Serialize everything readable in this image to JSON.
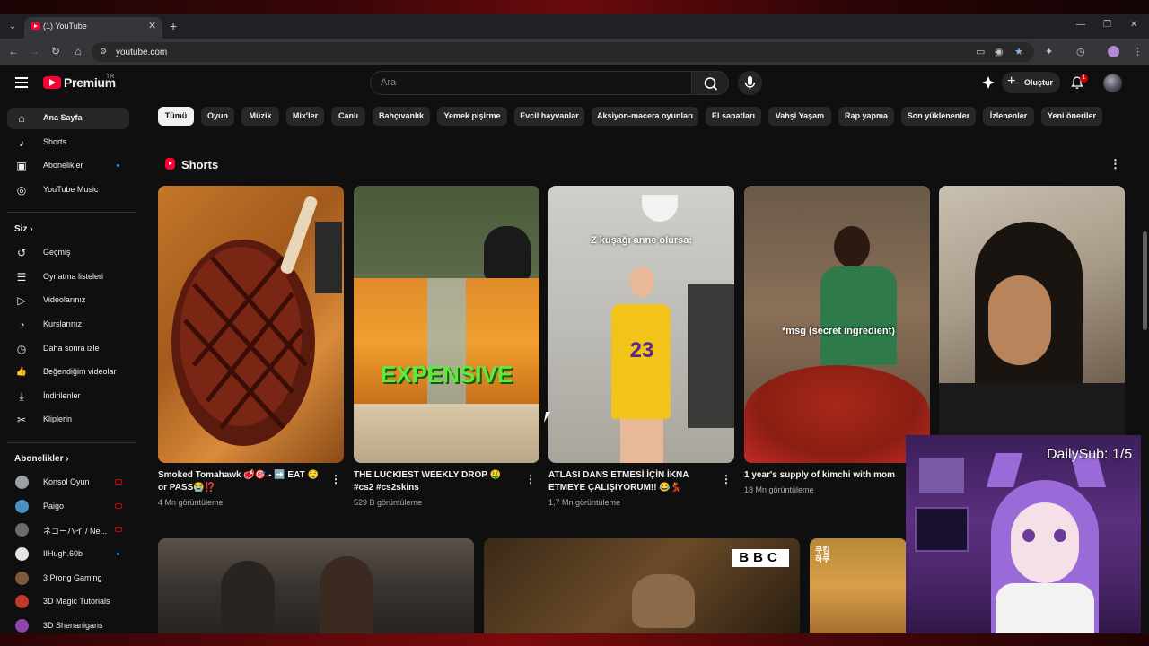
{
  "browser": {
    "tab_title": "(1) YouTube",
    "tab_close": "✕",
    "new_tab": "+",
    "url": "youtube.com",
    "window_controls": {
      "minimize": "—",
      "restore": "❐",
      "close": "✕"
    }
  },
  "masthead": {
    "logo_text": "Premium",
    "country": "TR",
    "search_placeholder": "Ara",
    "create_label": "Oluştur",
    "notification_count": "1"
  },
  "sidebar": {
    "main": [
      {
        "label": "Ana Sayfa",
        "icon": "home-icon",
        "glyph": "⌂"
      },
      {
        "label": "Shorts",
        "icon": "shorts-icon",
        "glyph": "♪"
      },
      {
        "label": "Abonelikler",
        "icon": "subscriptions-icon",
        "glyph": "▣"
      },
      {
        "label": "YouTube Music",
        "icon": "music-icon",
        "glyph": "◎"
      }
    ],
    "you_heading": "Siz",
    "you": [
      {
        "label": "Geçmiş",
        "icon": "history-icon",
        "glyph": "↺"
      },
      {
        "label": "Oynatma listeleri",
        "icon": "playlists-icon",
        "glyph": "☰"
      },
      {
        "label": "Videolarınız",
        "icon": "your-videos-icon",
        "glyph": "▷"
      },
      {
        "label": "Kurslarınız",
        "icon": "courses-icon",
        "glyph": "◔"
      },
      {
        "label": "Daha sonra izle",
        "icon": "watch-later-icon",
        "glyph": "◷"
      },
      {
        "label": "Beğendiğim videolar",
        "icon": "liked-videos-icon",
        "glyph": "👍"
      },
      {
        "label": "İndirilenler",
        "icon": "downloads-icon",
        "glyph": "⤓"
      },
      {
        "label": "Kliplerin",
        "icon": "clips-icon",
        "glyph": "✂"
      }
    ],
    "subs_heading": "Abonelikler",
    "subscriptions": [
      {
        "label": "Konsol Oyun",
        "indicator": "live",
        "color": "#9aa0a6"
      },
      {
        "label": "Paigo",
        "indicator": "live",
        "color": "#4a90c2"
      },
      {
        "label": "ネコーハイ / Ne...",
        "indicator": "live",
        "color": "#6b6b6b"
      },
      {
        "label": "IIHugh.60b",
        "indicator": "dot",
        "color": "#e6e6e6"
      },
      {
        "label": "3 Prong Gaming",
        "indicator": "none",
        "color": "#7a5a3a"
      },
      {
        "label": "3D Magic Tutorials",
        "indicator": "none",
        "color": "#c0392b"
      },
      {
        "label": "3D Shenanigans",
        "indicator": "none",
        "color": "#8e44ad"
      }
    ]
  },
  "chips": [
    "Tümü",
    "Oyun",
    "Müzik",
    "Mix'ler",
    "Canlı",
    "Bahçıvanlık",
    "Yemek pişirme",
    "Evcil hayvanlar",
    "Aksiyon-macera oyunları",
    "El sanatları",
    "Vahşi Yaşam",
    "Rap yapma",
    "Son yüklenenler",
    "İzlenenler",
    "Yeni öneriler"
  ],
  "shorts": {
    "title": "Shorts",
    "items": [
      {
        "title": "Smoked Tomahawk 🥩🎯 - ➡️ EAT 🤤 or PASS😭⁉️",
        "views": "4 Mn görüntüleme"
      },
      {
        "title": "THE LUCKIEST WEEKLY DROP 🤑 #cs2 #cs2skins",
        "views": "529 B görüntüleme",
        "overlay": "EXPENSIVE"
      },
      {
        "title": "ATLASI DANS ETMESİ İÇİN İKNA ETMEYE ÇALIŞIYORUM!! 😂💃",
        "views": "1,7 Mn görüntüleme",
        "overlay": "Z kuşağı anne olursa:"
      },
      {
        "title": "1 year's supply of kimchi with mom",
        "views": "18 Mn görüntüleme",
        "overlay": "*msg (secret ingredient)"
      },
      {
        "title": "",
        "views": ""
      }
    ]
  },
  "videos": [
    {
      "badge": ""
    },
    {
      "badge": "BBC"
    },
    {
      "badge": "쿠킹 하루"
    }
  ],
  "overlay": {
    "text": "DailySub: 1/5"
  },
  "colors": {
    "accent": "#ff0033",
    "background": "#0f0f0f",
    "chip": "#272727"
  }
}
